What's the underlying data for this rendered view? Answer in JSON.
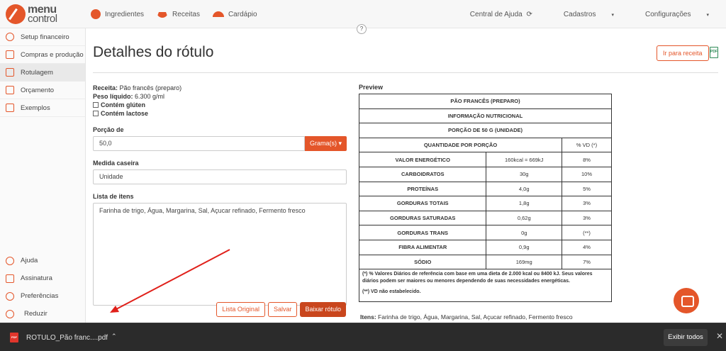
{
  "app": {
    "logo_line1": "menu",
    "logo_line2": "control",
    "nav": [
      {
        "label": "Ingredientes",
        "icon": "tomato-icon"
      },
      {
        "label": "Receitas",
        "icon": "bowl-icon"
      },
      {
        "label": "Cardápio",
        "icon": "cloche-icon"
      }
    ],
    "nav_right": {
      "help": "Central de Ajuda",
      "cadastros": "Cadastros",
      "config": "Configurações",
      "caret": "▾"
    },
    "help_dot": "?",
    "accent": "#e4562a"
  },
  "sidebar": {
    "items": [
      {
        "label": "Setup financeiro",
        "icon": "money-icon"
      },
      {
        "label": "Compras e produção",
        "icon": "clipboard-icon"
      },
      {
        "label": "Rotulagem",
        "icon": "label-icon"
      },
      {
        "label": "Orçamento",
        "icon": "budget-icon"
      },
      {
        "label": "Exemplos",
        "icon": "examples-icon"
      }
    ],
    "bottom": [
      {
        "label": "Ajuda",
        "icon": "help-icon"
      },
      {
        "label": "Assinatura",
        "icon": "card-icon"
      },
      {
        "label": "Preferências",
        "icon": "gear-icon"
      },
      {
        "label": "Reduzir",
        "icon": "collapse-icon"
      }
    ]
  },
  "page": {
    "title": "Detalhes do rótulo",
    "btn_receita": "Ir para receita",
    "pdf_label": "PDF"
  },
  "form": {
    "receita_label": "Receita:",
    "receita_value": "Pão francês (preparo)",
    "peso_label": "Peso líquido:",
    "peso_value": "6.300 g/ml",
    "gluten": "Contém glúten",
    "lactose": "Contém lactose",
    "porcao_label": "Porção de",
    "porcao_value": "50,0",
    "unit_btn": "Grama(s)",
    "medida_label": "Medida caseira",
    "medida_value": "Unidade",
    "lista_label": "Lista de itens",
    "lista_value": "Farinha de trigo, Água, Margarina, Sal, Açucar refinado, Fermento fresco",
    "btn_original": "Lista Original",
    "btn_salvar": "Salvar",
    "btn_baixar": "Baixar rótulo"
  },
  "preview": {
    "label": "Preview",
    "header1": "PÃO FRANCÊS (PREPARO)",
    "header2": "INFORMAÇÃO NUTRICIONAL",
    "header3": "PORÇÃO DE 50 G (UNIDADE)",
    "col_qty": "QUANTIDADE POR PORÇÃO",
    "col_vd": "% VD (*)",
    "rows": [
      {
        "name": "VALOR ENERGÉTICO",
        "qty": "160kcal = 669kJ",
        "vd": "8%"
      },
      {
        "name": "CARBOIDRATOS",
        "qty": "30g",
        "vd": "10%"
      },
      {
        "name": "PROTEÍNAS",
        "qty": "4,0g",
        "vd": "5%"
      },
      {
        "name": "GORDURAS TOTAIS",
        "qty": "1,8g",
        "vd": "3%"
      },
      {
        "name": "GORDURAS SATURADAS",
        "qty": "0,62g",
        "vd": "3%"
      },
      {
        "name": "GORDURAS TRANS",
        "qty": "0g",
        "vd": "(**)"
      },
      {
        "name": "FIBRA ALIMENTAR",
        "qty": "0,9g",
        "vd": "4%"
      },
      {
        "name": "SÓDIO",
        "qty": "169mg",
        "vd": "7%"
      }
    ],
    "footnote1": "(*) % Valores Diários de referência com base em uma dieta de 2.000 kcal ou 8400 kJ. Seus valores diários podem ser maiores ou menores dependendo de suas necessidades energéticas.",
    "footnote2": "(**) VD não estabelecido.",
    "items_label": "Itens:",
    "items_value": "Farinha de trigo, Água, Margarina, Sal, Açucar refinado, Fermento fresco"
  },
  "download": {
    "file_name": "ROTULO_Pão franc....pdf",
    "chevron": "⌃",
    "show_all": "Exibir todos",
    "close": "✕",
    "pdf_badge": "PDF"
  }
}
